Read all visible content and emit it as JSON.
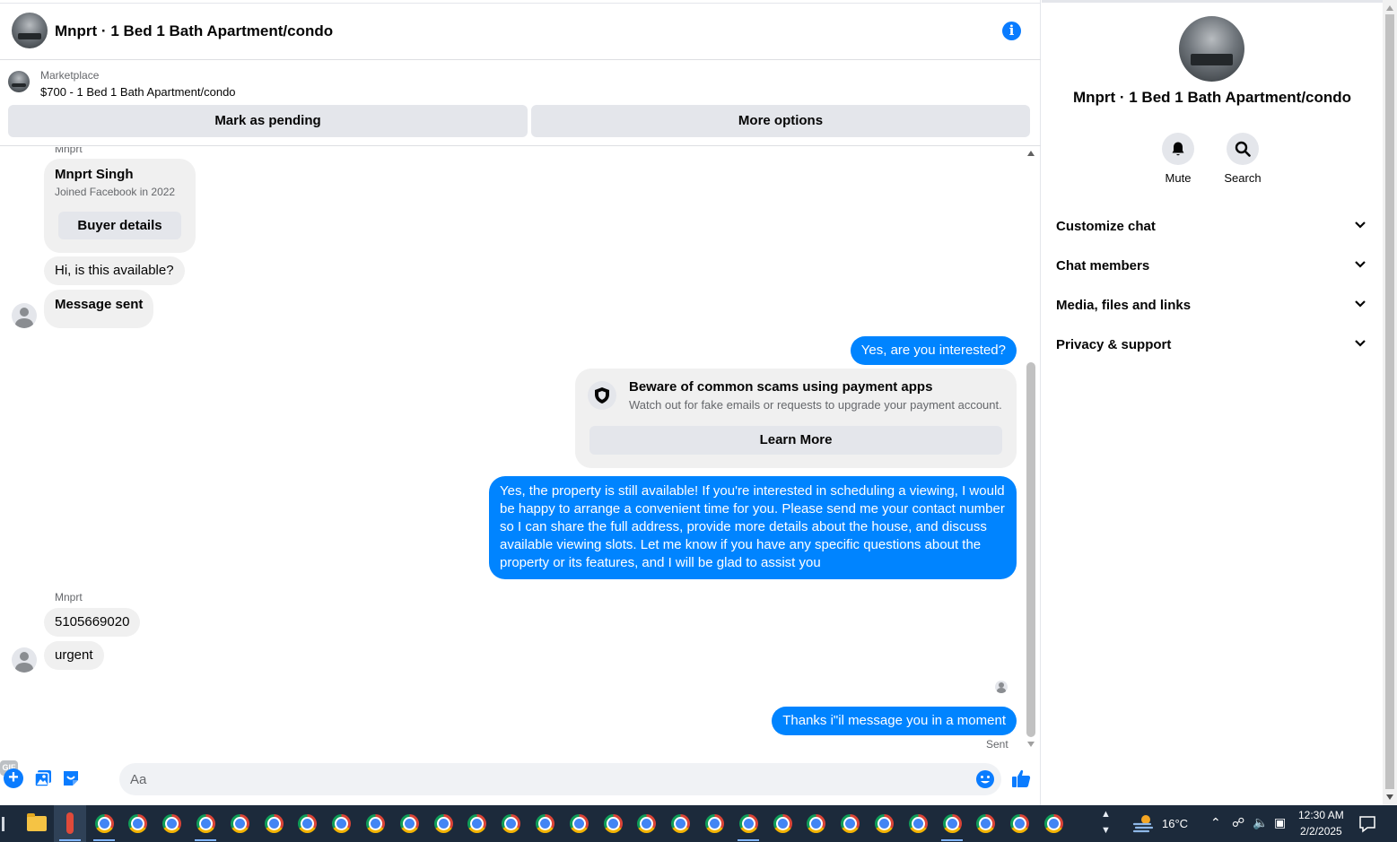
{
  "chat": {
    "title": "Mnprt · 1 Bed 1 Bath Apartment/condo",
    "listing": {
      "source": "Marketplace",
      "title": "$700 - 1 Bed 1 Bath Apartment/condo",
      "pending_label": "Mark as pending",
      "more_label": "More options"
    },
    "profile_card": {
      "sender_label": "Mnprt",
      "name": "Mnprt Singh",
      "joined": "Joined Facebook in 2022",
      "button": "Buyer details"
    },
    "messages": {
      "m1": "Hi, is this available?",
      "m2": "Message sent",
      "m3": "Yes, are you interested?",
      "m4": "Yes, the property is still available! If you're interested in scheduling a viewing, I would be happy to arrange a convenient time for you. Please send me your contact number so I can share the full address, provide more details about the house, and discuss available viewing slots. Let me know if you have any specific questions about the property or its features, and I will be glad to assist you",
      "sender2": "Mnprt",
      "m5": "5105669020",
      "m6": "urgent",
      "m7": "Thanks i\"il message you in a moment",
      "status": "Sent"
    },
    "scam_warning": {
      "title": "Beware of common scams using payment apps",
      "text": "Watch out for fake emails or requests to upgrade your payment account.",
      "button": "Learn More"
    },
    "composer": {
      "placeholder": "Aa",
      "gif_label": "GIF"
    }
  },
  "panel": {
    "title": "Mnprt · 1 Bed 1 Bath Apartment/condo",
    "actions": {
      "mute": "Mute",
      "search": "Search"
    },
    "sections": [
      "Customize chat",
      "Chat members",
      "Media, files and links",
      "Privacy & support"
    ]
  },
  "taskbar": {
    "temperature": "16°C",
    "time": "12:30 AM",
    "date": "2/2/2025"
  },
  "colors": {
    "accent": "#0084ff",
    "incoming_bubble": "#f0f0f0",
    "taskbar": "#1c2a3b"
  },
  "icons": [
    "info-icon",
    "shield-icon",
    "plus-icon",
    "photo-icon",
    "sticker-icon",
    "gif-icon",
    "emoji-icon",
    "like-icon",
    "bell-icon",
    "search-icon",
    "chevron-down-icon",
    "chrome-icon",
    "folder-icon",
    "weather-icon",
    "notification-icon"
  ]
}
